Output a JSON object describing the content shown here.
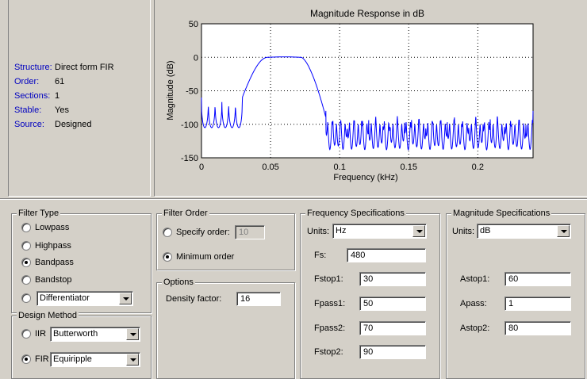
{
  "info": {
    "rows": [
      {
        "label": "Structure:",
        "value": "Direct form FIR"
      },
      {
        "label": "Order:",
        "value": "61"
      },
      {
        "label": "Sections:",
        "value": "1"
      },
      {
        "label": "Stable:",
        "value": "Yes"
      },
      {
        "label": "Source:",
        "value": "Designed"
      }
    ]
  },
  "plot": {
    "title": "Magnitude Response in dB",
    "ylabel": "Magnitude (dB)",
    "xlabel": "Frequency (kHz)",
    "yticks": [
      "50",
      "0",
      "-50",
      "-100",
      "-150"
    ],
    "xticks": [
      "0",
      "0.05",
      "0.1",
      "0.15",
      "0.2"
    ]
  },
  "chart_data": {
    "type": "line",
    "title": "Magnitude Response in dB",
    "xlabel": "Frequency (kHz)",
    "ylabel": "Magnitude (dB)",
    "xlim": [
      0,
      0.24
    ],
    "ylim": [
      -150,
      50
    ],
    "grid": true,
    "series": [
      {
        "x": [
          0,
          0.005,
          0.01,
          0.015,
          0.02,
          0.025,
          0.029,
          0.03,
          0.032,
          0.035,
          0.04,
          0.045,
          0.05,
          0.06,
          0.065,
          0.07,
          0.075,
          0.08,
          0.085,
          0.088,
          0.09,
          0.1,
          0.12,
          0.14,
          0.16,
          0.18,
          0.2,
          0.22,
          0.24
        ],
        "values": [
          -60,
          -100,
          -60,
          -100,
          -60,
          -100,
          -60,
          -60,
          -35,
          -15,
          -3,
          -0.5,
          0,
          0,
          1,
          0,
          -5,
          -20,
          -50,
          -80,
          -100,
          -80,
          -80,
          -80,
          -80,
          -80,
          -80,
          -80,
          -80
        ]
      }
    ]
  },
  "filter_type": {
    "title": "Filter Type",
    "options": [
      {
        "label": "Lowpass",
        "checked": false
      },
      {
        "label": "Highpass",
        "checked": false
      },
      {
        "label": "Bandpass",
        "checked": true
      },
      {
        "label": "Bandstop",
        "checked": false
      }
    ],
    "other_select": "Differentiator"
  },
  "design_method": {
    "title": "Design Method",
    "iir_label": "IIR",
    "iir_select": "Butterworth",
    "fir_label": "FIR",
    "fir_select": "Equiripple"
  },
  "filter_order": {
    "title": "Filter Order",
    "specify_label": "Specify order:",
    "specify_value": "10",
    "minimum_label": "Minimum order"
  },
  "options": {
    "title": "Options",
    "density_label": "Density factor:",
    "density_value": "16"
  },
  "freq_spec": {
    "title": "Frequency Specifications",
    "units_label": "Units:",
    "units_value": "Hz",
    "fs_label": "Fs:",
    "fs_value": "480",
    "fstop1_label": "Fstop1:",
    "fstop1_value": "30",
    "fpass1_label": "Fpass1:",
    "fpass1_value": "50",
    "fpass2_label": "Fpass2:",
    "fpass2_value": "70",
    "fstop2_label": "Fstop2:",
    "fstop2_value": "90"
  },
  "mag_spec": {
    "title": "Magnitude Specifications",
    "units_label": "Units:",
    "units_value": "dB",
    "astop1_label": "Astop1:",
    "astop1_value": "60",
    "apass_label": "Apass:",
    "apass_value": "1",
    "astop2_label": "Astop2:",
    "astop2_value": "80"
  }
}
